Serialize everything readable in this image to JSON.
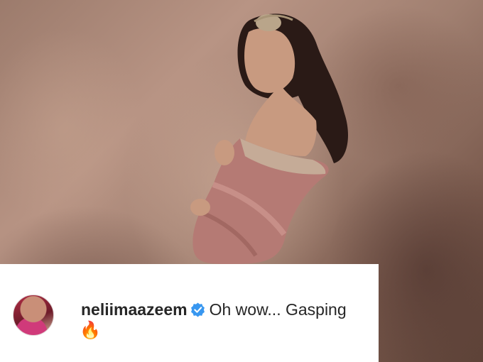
{
  "comment": {
    "username": "neliimaazeem",
    "text": "Oh wow... Gasping",
    "emoji": "🔥",
    "verified_color": "#3897f0"
  },
  "icons": {
    "avatar": "profile-avatar",
    "verified": "verified-badge-icon"
  }
}
